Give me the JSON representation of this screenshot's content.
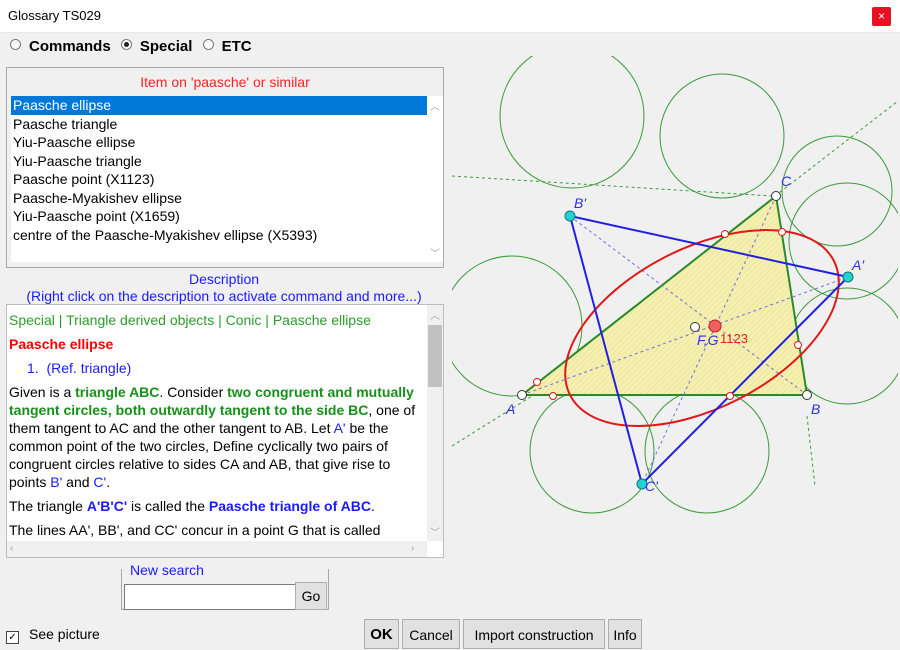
{
  "window": {
    "title": "Glossary   TS029",
    "close_label": "×"
  },
  "modes": [
    {
      "label": "Commands",
      "selected": false
    },
    {
      "label": "Special",
      "selected": true
    },
    {
      "label": "ETC",
      "selected": false
    }
  ],
  "item_box": {
    "title": "Item on 'paasche' or similar",
    "items": [
      "Paasche ellipse",
      "Paasche triangle",
      "Yiu-Paasche ellipse",
      "Yiu-Paasche triangle",
      "Paasche point (X1123)",
      "Paasche-Myakishev ellipse",
      "Yiu-Paasche point (X1659)",
      "centre of the Paasche-Myakishev ellipse (X5393)"
    ],
    "selected_index": 0
  },
  "description": {
    "heading": "Description",
    "hint": "(Right click on the description to activate command and more...)",
    "category_line": "Special | Triangle derived objects | Conic | Paasche ellipse",
    "item_title": "Paasche ellipse",
    "ref_number": "1.",
    "ref_text": "(Ref. triangle)",
    "p1_a": "Given is a ",
    "p1_b": "triangle ABC",
    "p1_c": ". Consider ",
    "p1_d": "two congruent and mutually tangent circles, both outwardly tangent to the side BC",
    "p1_e": ", one of them tangent to AC and the other tangent to AB. Let ",
    "p1_f": "A'",
    "p1_g": " be the common point of the two circles, Define cyclically two pairs of congruent circles relative to sides CA and AB, that give rise to points ",
    "p1_h": "B'",
    "p1_i": " and ",
    "p1_j": "C'",
    "p1_k": ".",
    "p2_a": "The triangle ",
    "p2_b": "A'B'C'",
    "p2_c": " is called the ",
    "p2_d": "Paasche triangle of ABC",
    "p2_e": ".",
    "p3": "The lines AA', BB', and CC' concur in a point G that is called"
  },
  "new_search": {
    "legend": "New search",
    "value": "",
    "go_label": "Go"
  },
  "see_picture": {
    "label": "See picture",
    "checked": true,
    "mark": "✓"
  },
  "buttons": {
    "ok": "OK",
    "cancel": "Cancel",
    "import": "Import construction",
    "info": "Info"
  },
  "figure": {
    "labels": {
      "A": "A",
      "B": "B",
      "C": "C",
      "A_prime": "A'",
      "B_prime": "B'",
      "C_prime": "C'",
      "point_x1123": "1123",
      "point_fg": "F,G"
    },
    "colors": {
      "triangle_fill": "#f5f0b0",
      "triangle_edge": "#2a8a2a",
      "paasche_triangle": "#2020e0",
      "ellipse": "#e01818",
      "circles": "#3a9a3a",
      "label": "#3030e0"
    }
  }
}
